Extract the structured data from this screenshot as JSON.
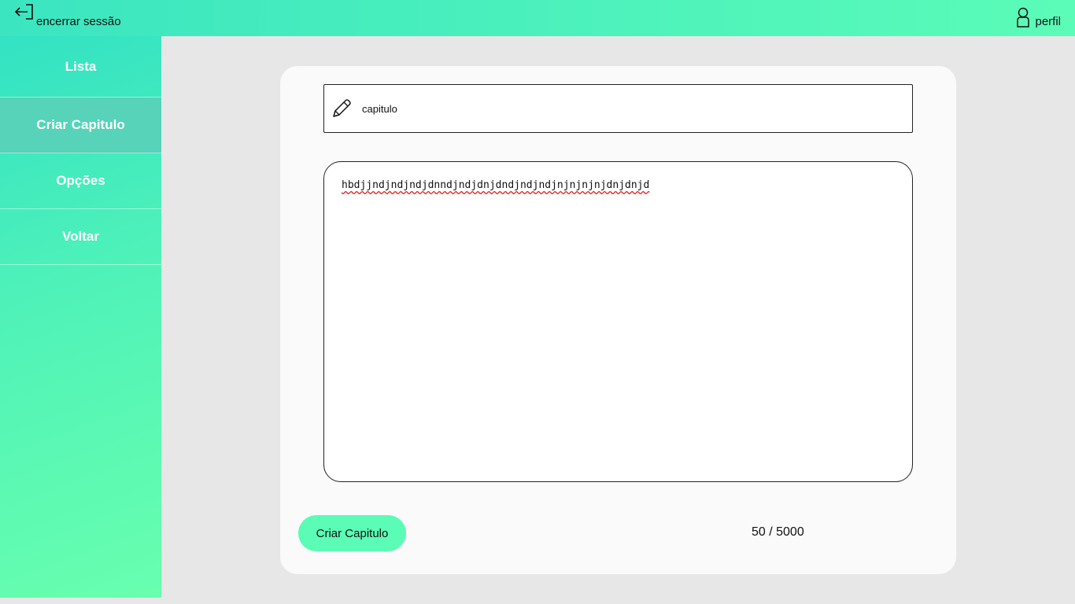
{
  "header": {
    "logout_label": "encerrar sessão",
    "logout_icon": "logout-arrow-icon",
    "profile_label": "perfil",
    "profile_icon": "user-icon"
  },
  "sidebar": {
    "items": [
      {
        "label": "Lista",
        "active": false
      },
      {
        "label": "Criar Capitulo",
        "active": true
      },
      {
        "label": "Opções",
        "active": false
      },
      {
        "label": "Voltar",
        "active": false
      }
    ]
  },
  "form": {
    "title_icon": "pencil-icon",
    "title_value": "capitulo",
    "content_value": "hbdjjndjndjndjdnndjndjdnjdndjndjndjnjnjnjnjdnjdnjd",
    "submit_label": "Criar Capitulo",
    "char_count": "50 / 5000"
  },
  "colors": {
    "gradient_start": "#3be5c0",
    "gradient_end": "#5bfcb8",
    "button": "#5bfcb5",
    "active_nav": "#56d3b8",
    "page_bg": "#e7e7e7"
  }
}
